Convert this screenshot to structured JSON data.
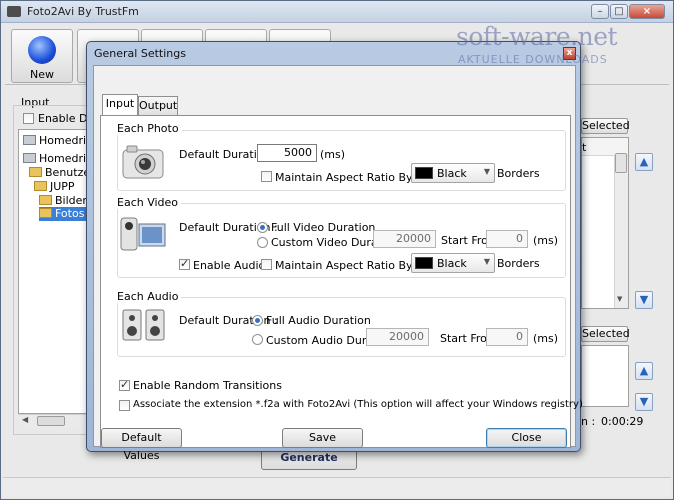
{
  "app": {
    "title": "Foto2Avi By TrustFm"
  },
  "toolbar": {
    "new_label": "New",
    "generate_label": "Generate"
  },
  "left_panel": {
    "section_label": "Input",
    "enable_drag_label": "Enable Drag",
    "tree": [
      {
        "label": "Homedrive",
        "type": "drive"
      },
      {
        "label": "Homedrive (I",
        "type": "drive"
      },
      {
        "label": "Benutzer",
        "type": "folder"
      },
      {
        "label": "JUPP",
        "type": "folder"
      },
      {
        "label": "Bilder",
        "type": "folder"
      },
      {
        "label": "Fotos",
        "type": "folder",
        "selected": true
      }
    ]
  },
  "right_panel": {
    "selected_label_1": "Selected",
    "selected_label_2": "Selected",
    "column_fragment": "t",
    "duration_label": "n :",
    "duration_value": "0:00:29"
  },
  "watermark": {
    "main": "soft-ware.net",
    "sub": "AKTUELLE DOWNLOADS"
  },
  "dialog": {
    "title": "General Settings",
    "close_glyph": "x",
    "tabs": [
      "Input",
      "Output"
    ],
    "photo": {
      "title": "Each Photo",
      "default_duration_label": "Default Duration :",
      "duration_value": "5000",
      "unit": "(ms)",
      "aspect_label": "Maintain Aspect Ratio By Adding",
      "aspect_checked": false,
      "color_value": "Black",
      "borders_label": "Borders"
    },
    "video": {
      "title": "Each Video",
      "default_duration_label": "Default Duration :",
      "full_label": "Full Video Duration",
      "full_selected": true,
      "custom_label": "Custom Video Duration :",
      "custom_value": "20000",
      "start_from_label": "Start From :",
      "start_value": "0",
      "unit": "(ms)",
      "enable_audio_label": "Enable Audio",
      "enable_audio_checked": true,
      "aspect_label": "Maintain Aspect Ratio By Adding",
      "aspect_checked": false,
      "color_value": "Black",
      "borders_label": "Borders"
    },
    "audio": {
      "title": "Each Audio",
      "default_duration_label": "Default Duration :",
      "full_label": "Full Audio Duration",
      "full_selected": true,
      "custom_label": "Custom Audio Duration :",
      "custom_value": "20000",
      "start_from_label": "Start From :",
      "start_value": "0",
      "unit": "(ms)"
    },
    "random_transitions_label": "Enable Random Transitions",
    "random_transitions_checked": true,
    "associate_label": "Associate the extension *.f2a with Foto2Avi (This option will affect your Windows registry)",
    "associate_checked": false,
    "buttons": {
      "default": "Default Values",
      "save": "Save",
      "close": "Close"
    }
  },
  "colors": {
    "accent": "#3a6fbf",
    "dialog_frame": "#a9bedc",
    "selection": "#3b7fd6"
  }
}
